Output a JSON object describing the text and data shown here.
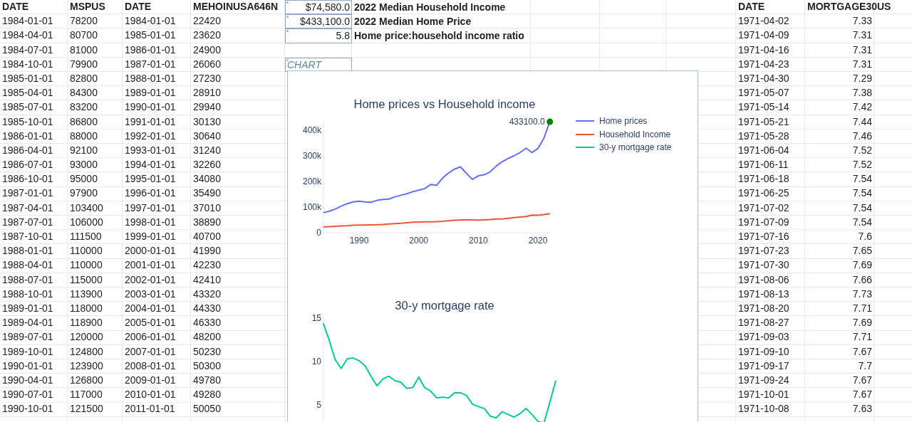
{
  "left_table": {
    "columns": [
      "DATE",
      "MSPUS",
      "DATE",
      "MEHOINUSA646N"
    ],
    "rows": [
      [
        "1984-01-01",
        "78200",
        "1984-01-01",
        "22420"
      ],
      [
        "1984-04-01",
        "80700",
        "1985-01-01",
        "23620"
      ],
      [
        "1984-07-01",
        "81000",
        "1986-01-01",
        "24900"
      ],
      [
        "1984-10-01",
        "79900",
        "1987-01-01",
        "26060"
      ],
      [
        "1985-01-01",
        "82800",
        "1988-01-01",
        "27230"
      ],
      [
        "1985-04-01",
        "84300",
        "1989-01-01",
        "28910"
      ],
      [
        "1985-07-01",
        "83200",
        "1990-01-01",
        "29940"
      ],
      [
        "1985-10-01",
        "86800",
        "1991-01-01",
        "30130"
      ],
      [
        "1986-01-01",
        "88000",
        "1992-01-01",
        "30640"
      ],
      [
        "1986-04-01",
        "92100",
        "1993-01-01",
        "31240"
      ],
      [
        "1986-07-01",
        "93000",
        "1994-01-01",
        "32260"
      ],
      [
        "1986-10-01",
        "95000",
        "1995-01-01",
        "34080"
      ],
      [
        "1987-01-01",
        "97900",
        "1996-01-01",
        "35490"
      ],
      [
        "1987-04-01",
        "103400",
        "1997-01-01",
        "37010"
      ],
      [
        "1987-07-01",
        "106000",
        "1998-01-01",
        "38890"
      ],
      [
        "1987-10-01",
        "111500",
        "1999-01-01",
        "40700"
      ],
      [
        "1988-01-01",
        "110000",
        "2000-01-01",
        "41990"
      ],
      [
        "1988-04-01",
        "110000",
        "2001-01-01",
        "42230"
      ],
      [
        "1988-07-01",
        "115000",
        "2002-01-01",
        "42410"
      ],
      [
        "1988-10-01",
        "113900",
        "2003-01-01",
        "43320"
      ],
      [
        "1989-01-01",
        "118000",
        "2004-01-01",
        "44330"
      ],
      [
        "1989-04-01",
        "118900",
        "2005-01-01",
        "46330"
      ],
      [
        "1989-07-01",
        "120000",
        "2006-01-01",
        "48200"
      ],
      [
        "1989-10-01",
        "124800",
        "2007-01-01",
        "50230"
      ],
      [
        "1990-01-01",
        "123900",
        "2008-01-01",
        "50300"
      ],
      [
        "1990-04-01",
        "126800",
        "2009-01-01",
        "49780"
      ],
      [
        "1990-07-01",
        "117000",
        "2010-01-01",
        "49280"
      ],
      [
        "1990-10-01",
        "121500",
        "2011-01-01",
        "50050"
      ]
    ]
  },
  "summary": [
    {
      "value": "$74,580.0",
      "description": "2022 Median Household Income"
    },
    {
      "value": "$433,100.0",
      "description": "2022 Median Home Price"
    },
    {
      "value": "5.8",
      "description": "Home price:household income ratio"
    }
  ],
  "chart_label": "CHART",
  "chart_panel": {
    "charts": [
      {
        "chart_data": {
          "type": "line",
          "title": "Home prices vs Household income",
          "x": [
            1984,
            1985,
            1986,
            1987,
            1988,
            1989,
            1990,
            1991,
            1992,
            1993,
            1994,
            1995,
            1996,
            1997,
            1998,
            1999,
            2000,
            2001,
            2002,
            2003,
            2004,
            2005,
            2006,
            2007,
            2008,
            2009,
            2010,
            2011,
            2012,
            2013,
            2014,
            2015,
            2016,
            2017,
            2018,
            2019,
            2020,
            2021,
            2022
          ],
          "series": [
            {
              "name": "Home prices",
              "color": "#636efa",
              "values": [
                78000,
                84000,
                92000,
                104000,
                113000,
                120000,
                123000,
                120000,
                119000,
                126000,
                130000,
                131000,
                140000,
                146000,
                152000,
                160000,
                166000,
                172000,
                188000,
                185000,
                213000,
                233000,
                248000,
                257000,
                232000,
                208000,
                222000,
                226000,
                238000,
                260000,
                277000,
                290000,
                300000,
                313000,
                330000,
                313000,
                329000,
                369000,
                433100
              ]
            },
            {
              "name": "Household Income",
              "color": "#ef553b",
              "values": [
                22420,
                23620,
                24900,
                26060,
                27230,
                28910,
                29940,
                30130,
                30640,
                31240,
                32260,
                34080,
                35490,
                37010,
                38890,
                40700,
                41990,
                42230,
                42410,
                43320,
                44330,
                46330,
                48200,
                50230,
                50300,
                49780,
                49280,
                50050,
                51020,
                53590,
                53660,
                56520,
                59040,
                61140,
                63180,
                68700,
                68010,
                70780,
                74580
              ]
            }
          ],
          "xlim": [
            1984,
            2022
          ],
          "ylim": [
            0,
            433100
          ],
          "xticks": [
            1990,
            2000,
            2010,
            2020
          ],
          "yticks": [
            {
              "value": 0,
              "label": "0"
            },
            {
              "value": 100000,
              "label": "100k"
            },
            {
              "value": 200000,
              "label": "200k"
            },
            {
              "value": 300000,
              "label": "300k"
            },
            {
              "value": 400000,
              "label": "400k"
            }
          ],
          "annotations": [
            {
              "x": 2022,
              "y": 433100,
              "text": "433100.0"
            }
          ]
        }
      },
      {
        "chart_data": {
          "type": "line",
          "title": "30-y mortgage rate",
          "categories": [
            null,
            null,
            null,
            null,
            null,
            null,
            null,
            null,
            null,
            null,
            null,
            null,
            null,
            null,
            null,
            null,
            null,
            null,
            null,
            null,
            null,
            null,
            null,
            null,
            null,
            null,
            null,
            null,
            null,
            null,
            null,
            null,
            null,
            null,
            null,
            null,
            null,
            null,
            null,
            null
          ],
          "series": [
            {
              "name": "30-y mortgage rate",
              "color": "#00cc96",
              "values": [
                14.4,
                12.4,
                10.2,
                9.2,
                10.3,
                10.4,
                10.1,
                9.5,
                8.3,
                7.2,
                8.0,
                8.3,
                7.8,
                7.6,
                6.9,
                7.0,
                8.2,
                7.0,
                6.6,
                5.8,
                5.9,
                5.8,
                6.4,
                6.4,
                6.1,
                5.1,
                4.8,
                4.6,
                3.7,
                3.5,
                4.2,
                3.9,
                3.6,
                4.0,
                4.6,
                3.9,
                3.1,
                2.9,
                5.3,
                7.8
              ]
            }
          ],
          "ylim": [
            2.9,
            15
          ],
          "yticks": [
            5,
            10,
            15
          ]
        }
      }
    ]
  },
  "right_table": {
    "columns": [
      "DATE",
      "MORTGAGE30US"
    ],
    "rows": [
      [
        "1971-04-02",
        "7.33"
      ],
      [
        "1971-04-09",
        "7.31"
      ],
      [
        "1971-04-16",
        "7.31"
      ],
      [
        "1971-04-23",
        "7.31"
      ],
      [
        "1971-04-30",
        "7.29"
      ],
      [
        "1971-05-07",
        "7.38"
      ],
      [
        "1971-05-14",
        "7.42"
      ],
      [
        "1971-05-21",
        "7.44"
      ],
      [
        "1971-05-28",
        "7.46"
      ],
      [
        "1971-06-04",
        "7.52"
      ],
      [
        "1971-06-11",
        "7.52"
      ],
      [
        "1971-06-18",
        "7.54"
      ],
      [
        "1971-06-25",
        "7.54"
      ],
      [
        "1971-07-02",
        "7.54"
      ],
      [
        "1971-07-09",
        "7.54"
      ],
      [
        "1971-07-16",
        "7.6"
      ],
      [
        "1971-07-23",
        "7.65"
      ],
      [
        "1971-07-30",
        "7.69"
      ],
      [
        "1971-08-06",
        "7.66"
      ],
      [
        "1971-08-13",
        "7.73"
      ],
      [
        "1971-08-20",
        "7.71"
      ],
      [
        "1971-08-27",
        "7.69"
      ],
      [
        "1971-09-03",
        "7.71"
      ],
      [
        "1971-09-10",
        "7.67"
      ],
      [
        "1971-09-17",
        "7.7"
      ],
      [
        "1971-09-24",
        "7.67"
      ],
      [
        "1971-10-01",
        "7.67"
      ],
      [
        "1971-10-08",
        "7.63"
      ]
    ]
  }
}
